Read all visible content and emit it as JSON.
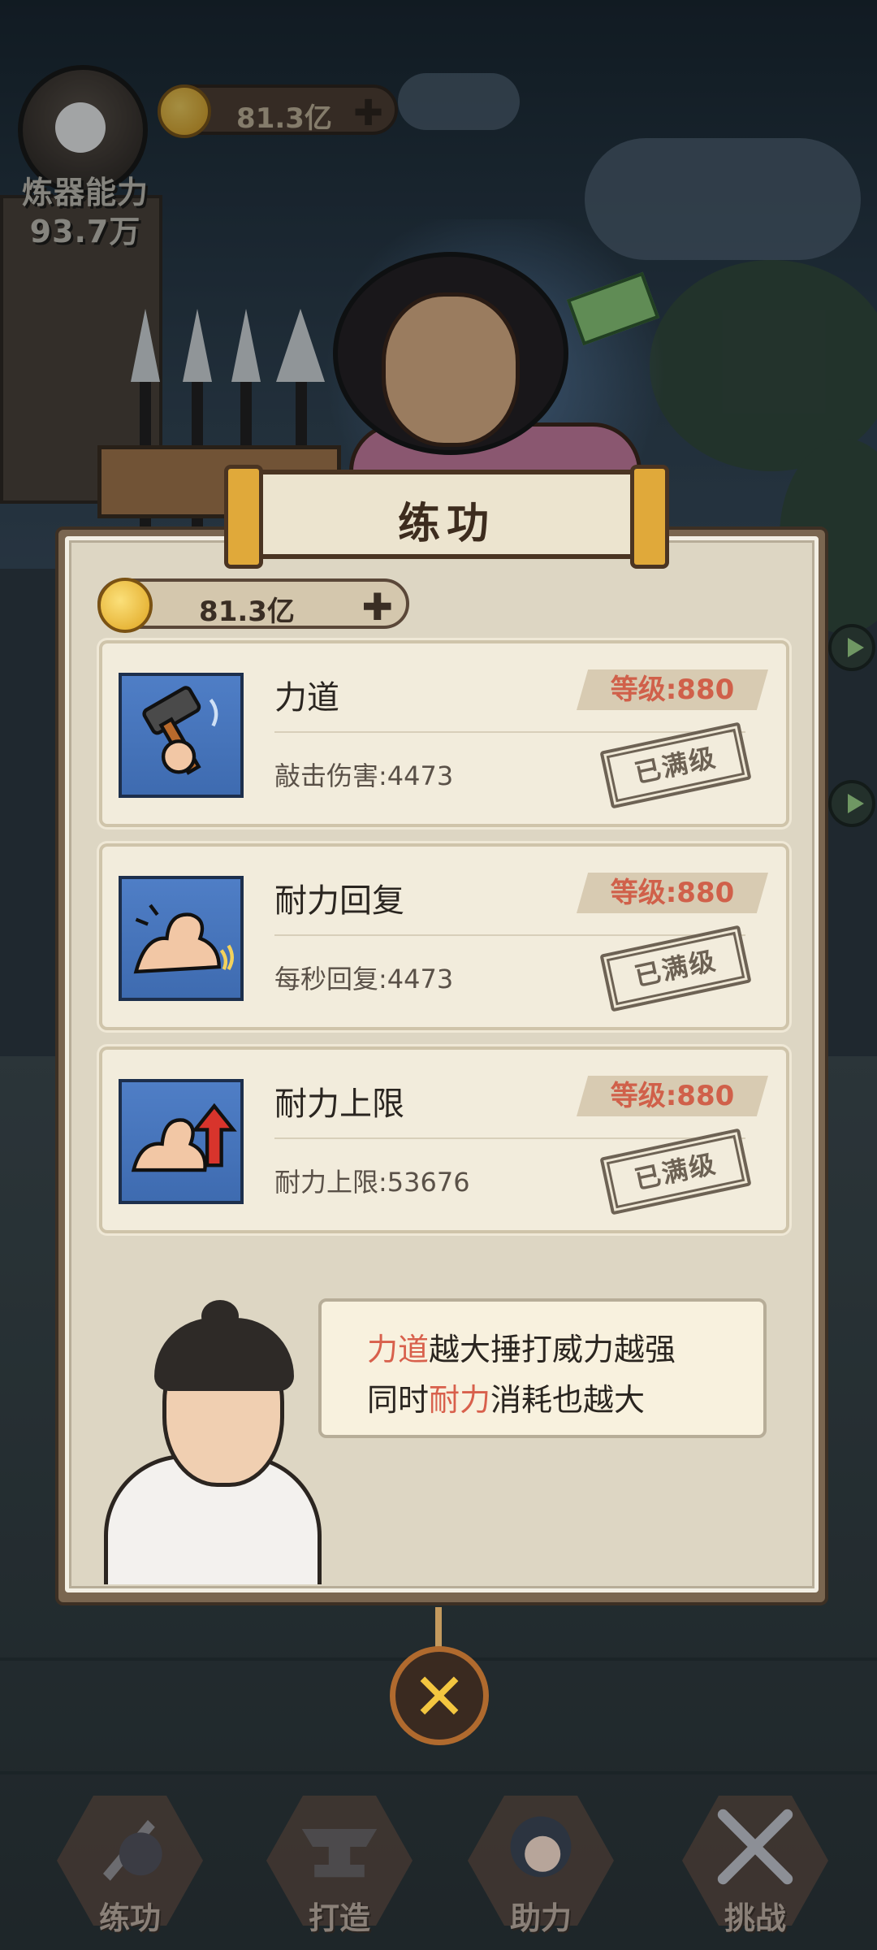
{
  "hud": {
    "stat_label": "炼器能力",
    "stat_value": "93.7万",
    "coins": "81.3亿"
  },
  "panel": {
    "title": "练功",
    "coins": "81.3亿"
  },
  "skills": [
    {
      "name": "力道",
      "level": "等级:880",
      "desc": "敲击伤害:4473",
      "status": "已满级",
      "icon": "hammer-icon"
    },
    {
      "name": "耐力回复",
      "level": "等级:880",
      "desc": "每秒回复:4473",
      "status": "已满级",
      "icon": "flex-arm-icon"
    },
    {
      "name": "耐力上限",
      "level": "等级:880",
      "desc": "耐力上限:53676",
      "status": "已满级",
      "icon": "arm-up-arrow-icon"
    }
  ],
  "hint": {
    "line1_hl": "力道",
    "line1_rest": "越大捶打威力越强",
    "line2_pre": "同时",
    "line2_hl": "耐力",
    "line2_rest": "消耗也越大"
  },
  "nav": [
    {
      "label": "练功",
      "icon": "sword-helmet-icon"
    },
    {
      "label": "打造",
      "icon": "anvil-icon"
    },
    {
      "label": "助力",
      "icon": "girl-avatar-icon"
    },
    {
      "label": "挑战",
      "icon": "crossed-swords-icon"
    }
  ],
  "colors": {
    "highlight": "#d8604c",
    "level_text": "#d0604a",
    "coin": "#e0a520"
  }
}
